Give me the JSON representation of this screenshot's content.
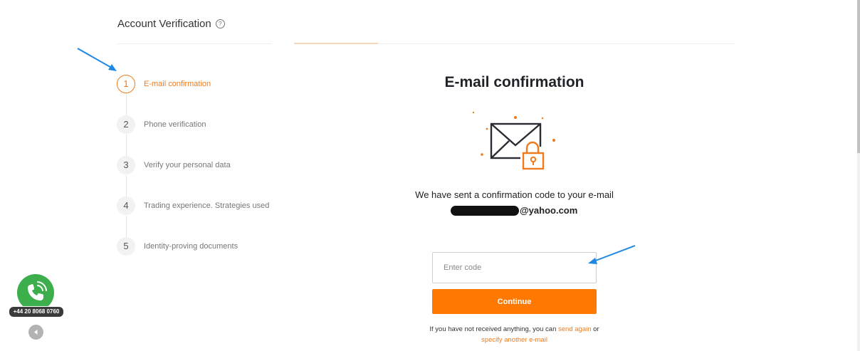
{
  "header": {
    "title": "Account Verification",
    "help_glyph": "?"
  },
  "steps": [
    {
      "number": "1",
      "label": "E-mail confirmation",
      "state": "active"
    },
    {
      "number": "2",
      "label": "Phone verification",
      "state": "pending"
    },
    {
      "number": "3",
      "label": "Verify your personal data",
      "state": "pending"
    },
    {
      "number": "4",
      "label": "Trading experience. Strategies used",
      "state": "pending"
    },
    {
      "number": "5",
      "label": "Identity-proving documents",
      "state": "pending"
    }
  ],
  "main": {
    "title": "E-mail confirmation",
    "illustration_icon": "envelope-lock-icon",
    "sent_text": "We have sent a confirmation code to your e-mail",
    "email_domain": "@yahoo.com",
    "code_input": {
      "placeholder": "Enter code",
      "value": ""
    },
    "continue_label": "Continue",
    "help": {
      "prefix": "If you have not received anything, you can",
      "send_again": "send again",
      "or": "or",
      "specify_another": "specify another e-mail"
    }
  },
  "widgets": {
    "phone_number": "+44 20 8068 0760",
    "phone_icon": "phone-call-icon",
    "collapse_icon": "chevron-left-icon"
  },
  "colors": {
    "accent": "#ff7800",
    "link": "#f07b1c",
    "phone_green": "#3cae4b",
    "annotation_arrow": "#1e88e5"
  }
}
